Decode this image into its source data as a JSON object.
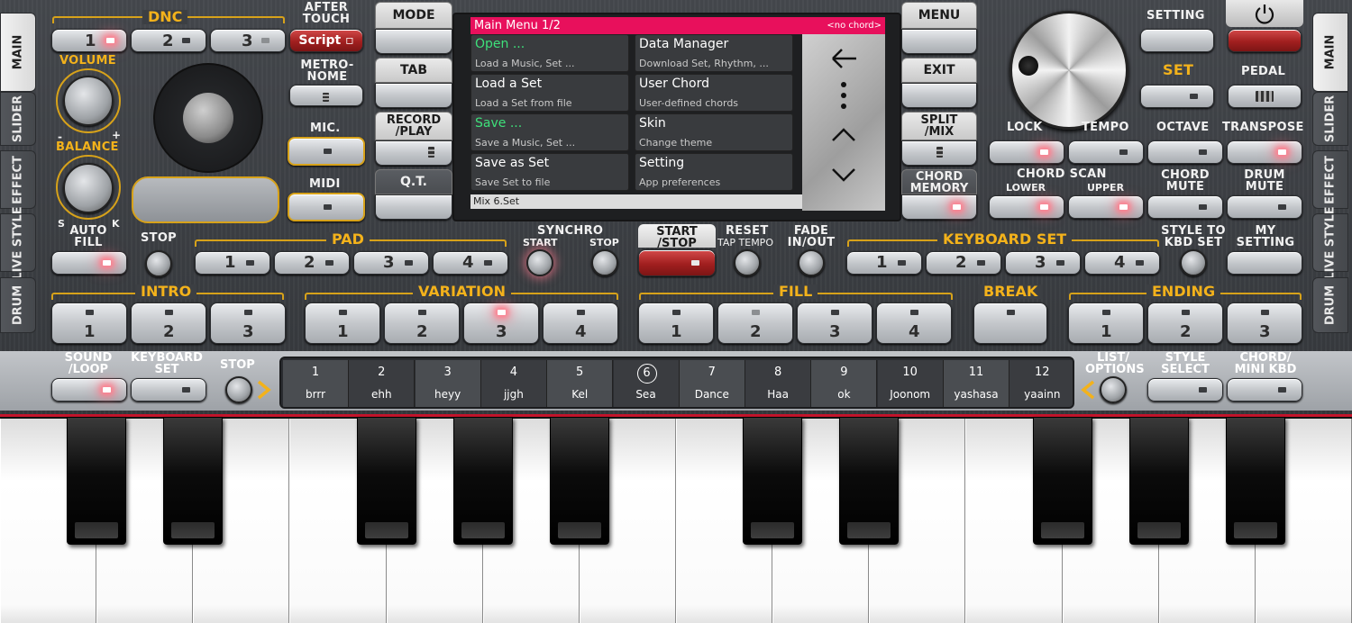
{
  "side_tabs_left": [
    {
      "label": "MAIN",
      "active": true
    },
    {
      "label": "SLIDER",
      "active": false
    },
    {
      "label": "EFFECT",
      "active": false
    },
    {
      "label": "LIVE STYLE",
      "active": false
    },
    {
      "label": "DRUM",
      "active": false
    }
  ],
  "side_tabs_right": [
    {
      "label": "MAIN",
      "active": true
    },
    {
      "label": "SLIDER",
      "active": false
    },
    {
      "label": "EFFECT",
      "active": false
    },
    {
      "label": "LIVE STYLE",
      "active": false
    },
    {
      "label": "DRUM",
      "active": false
    }
  ],
  "dnc": {
    "title": "DNC",
    "buttons": [
      "1",
      "2",
      "3"
    ],
    "after_touch": "AFTER\nTOUCH",
    "script": "Script"
  },
  "volume": "VOLUME",
  "balance": "BALANCE",
  "balance_minus": "-",
  "balance_plus": "+",
  "balance_s": "S",
  "balance_k": "K",
  "metronome": "METRO-\nNOME",
  "mic": "MIC.",
  "midi": "MIDI",
  "center_left_tabs": {
    "mode": "MODE",
    "tab": "TAB",
    "record": "RECORD\n/PLAY",
    "qt": "Q.T."
  },
  "center_right_tabs": {
    "menu": "MENU",
    "exit": "EXIT",
    "split": "SPLIT\n/MIX",
    "chord_memory": "CHORD\nMEMORY"
  },
  "screen": {
    "title": "Main Menu  1/2",
    "chord": "<no chord>",
    "items": [
      {
        "title": "Open ...",
        "desc": "Load a Music, Set ...",
        "green": true
      },
      {
        "title": "Data Manager",
        "desc": "Download Set, Rhythm, ...",
        "green": false
      },
      {
        "title": "Load a Set",
        "desc": "Load a Set from file",
        "green": false
      },
      {
        "title": "User Chord",
        "desc": "User-defined chords",
        "green": false
      },
      {
        "title": "Save ...",
        "desc": "Save a Music, Set ...",
        "green": true
      },
      {
        "title": "Skin",
        "desc": "Change theme",
        "green": false
      },
      {
        "title": "Save as Set",
        "desc": "Save Set to file",
        "green": false
      },
      {
        "title": "Setting",
        "desc": "App preferences",
        "green": false
      }
    ],
    "footer": "Mix 6.Set"
  },
  "right_top": {
    "setting": "SETTING",
    "set": "SET",
    "pedal": "PEDAL",
    "lock": "LOCK",
    "tempo": "TEMPO",
    "octave": "OCTAVE",
    "transpose": "TRANSPOSE",
    "chord_scan": "CHORD SCAN",
    "lower": "LOWER",
    "upper": "UPPER",
    "chord_mute": "CHORD\nMUTE",
    "drum_mute": "DRUM\nMUTE"
  },
  "row3": {
    "auto_fill": "AUTO\nFILL",
    "stop": "STOP",
    "pad": "PAD",
    "pad_buttons": [
      "1",
      "2",
      "3",
      "4"
    ],
    "synchro": "SYNCHRO",
    "synchro_start": "START",
    "synchro_stop": "STOP",
    "start_stop": "START\n/STOP",
    "reset": "RESET",
    "tap_tempo": "TAP TEMPO",
    "fade": "FADE\nIN/OUT",
    "keyboard_set": "KEYBOARD SET",
    "kbd_buttons": [
      "1",
      "2",
      "3",
      "4"
    ],
    "style_to_kbd": "STYLE TO\nKBD SET",
    "my_setting": "MY\nSETTING"
  },
  "row4": {
    "intro": "INTRO",
    "intro_buttons": [
      "1",
      "2",
      "3"
    ],
    "variation": "VARIATION",
    "variation_buttons": [
      "1",
      "2",
      "3",
      "4"
    ],
    "fill": "FILL",
    "fill_buttons": [
      "1",
      "2",
      "3",
      "4"
    ],
    "break": "BREAK",
    "ending": "ENDING",
    "ending_buttons": [
      "1",
      "2",
      "3"
    ]
  },
  "row5": {
    "sound_loop": "SOUND\n/LOOP",
    "keyboard_set": "KEYBOARD\nSET",
    "stop": "STOP",
    "list_options": "LIST/\nOPTIONS",
    "style_select": "STYLE\nSELECT",
    "chord_mini_kbd": "CHORD/\nMINI KBD"
  },
  "slots": [
    {
      "n": "1",
      "s": "brrr"
    },
    {
      "n": "2",
      "s": "ehh"
    },
    {
      "n": "3",
      "s": "heyy"
    },
    {
      "n": "4",
      "s": "jjgh"
    },
    {
      "n": "5",
      "s": "Kel"
    },
    {
      "n": "6",
      "s": "Sea"
    },
    {
      "n": "7",
      "s": "Dance"
    },
    {
      "n": "8",
      "s": "Haa"
    },
    {
      "n": "9",
      "s": "ok"
    },
    {
      "n": "10",
      "s": "Joonom"
    },
    {
      "n": "11",
      "s": "yashasa"
    },
    {
      "n": "12",
      "s": "yaainn"
    }
  ],
  "colors": {
    "accent": "#f3b21b",
    "screen_header": "#e8105c",
    "green_text": "#3ee07a",
    "led": "#ff7f8e",
    "piano_border": "#c4142b"
  }
}
